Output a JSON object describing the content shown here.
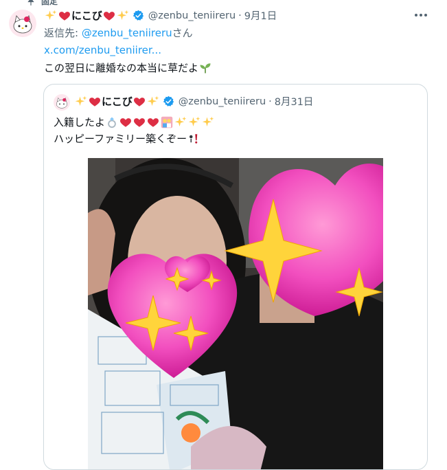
{
  "pinned": {
    "label": "固定"
  },
  "tweet": {
    "display_name_text": "にこび",
    "handle": "@zenbu_teniireru",
    "date": "9月1日",
    "reply_prefix": "返信先: ",
    "reply_handle": "@zenbu_teniireru",
    "reply_suffix": "さん",
    "link": "x.com/zenbu_teniirer...",
    "text": "この翌日に離婚なの本当に草だよ"
  },
  "quote": {
    "display_name_text": "にこび",
    "handle": "@zenbu_teniireru",
    "date": "8月31日",
    "line1": "入籍したよ",
    "line2": "ハッピーファミリー築くぞー"
  },
  "colors": {
    "link": "#1d9bf0",
    "muted": "#536471",
    "border": "#cfd9de",
    "verified": "#1d9bf0"
  },
  "icons": [
    "pin-icon",
    "sparkles-icon",
    "heart-icon",
    "verified-badge-icon",
    "more-icon",
    "ring-icon",
    "couple-icon",
    "exclamation-icon",
    "seedling-icon"
  ]
}
